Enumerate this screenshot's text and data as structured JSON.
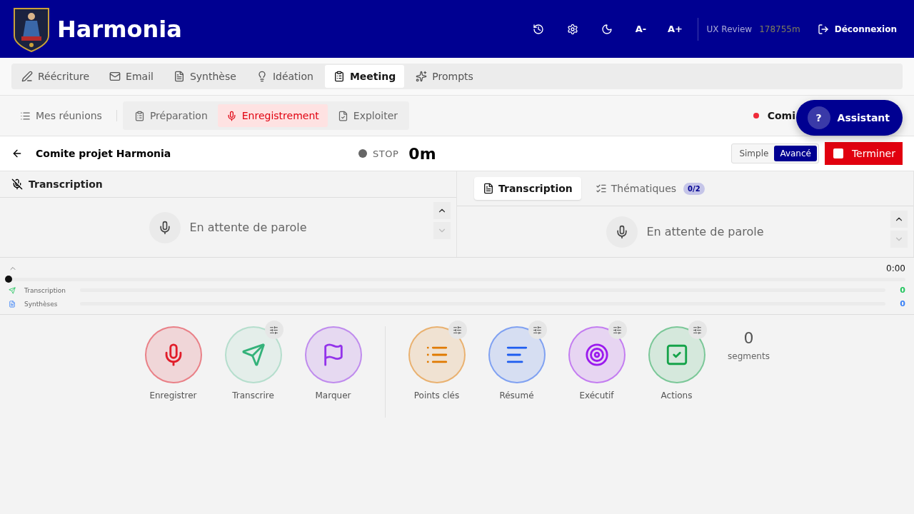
{
  "header": {
    "title": "Harmonia",
    "font_buttons": [
      "A-",
      "A+"
    ],
    "user": "UX Review",
    "usage": "178755m",
    "logout": "Déconnexion"
  },
  "main_tabs": [
    {
      "label": "Réécriture",
      "kind": "pen",
      "selected": false
    },
    {
      "label": "Email",
      "kind": "mail",
      "selected": false
    },
    {
      "label": "Synthèse",
      "kind": "doc",
      "selected": false
    },
    {
      "label": "Idéation",
      "kind": "bulb",
      "selected": false
    },
    {
      "label": "Meeting",
      "kind": "clipboard",
      "selected": true
    },
    {
      "label": "Prompts",
      "kind": "sparkles",
      "selected": false
    }
  ],
  "sub_nav": {
    "list_link": "Mes réunions",
    "steps": [
      {
        "label": "Préparation",
        "kind": "clipboard",
        "selected": false
      },
      {
        "label": "Enregistrement",
        "kind": "mic",
        "selected": true
      },
      {
        "label": "Exploiter",
        "kind": "filecheck",
        "selected": false
      }
    ],
    "status": {
      "text": "Comi",
      "color": "#ef2b3a"
    },
    "assistant": {
      "icon_text": "?",
      "label": "Assistant"
    }
  },
  "meeting_bar": {
    "title": "Comite projet Harmonia",
    "state": "STOP",
    "recording": false,
    "elapsed": "0m",
    "modes": [
      {
        "label": "Simple",
        "selected": false
      },
      {
        "label": "Avancé",
        "selected": true
      }
    ],
    "finish": "Terminer"
  },
  "left_panel": {
    "title": "Transcription",
    "empty_text": "En attente de parole"
  },
  "right_panel": {
    "tabs": [
      {
        "label": "Transcription",
        "kind": "doc",
        "selected": true
      },
      {
        "label": "Thématiques",
        "kind": "checklist",
        "selected": false,
        "badge": "0/2"
      }
    ],
    "empty_text": "En attente de parole"
  },
  "timeline": {
    "time": "0:00",
    "level": 0,
    "tracks": [
      {
        "label": "Transcription",
        "kind": "send",
        "color": "#22c55e",
        "count": "0",
        "level": 0
      },
      {
        "label": "Synthèses",
        "kind": "doc",
        "color": "#3b82f6",
        "count": "0",
        "level": 0
      }
    ]
  },
  "action_groups": [
    {
      "actions": [
        {
          "label": "Enregistrer",
          "kind": "mic",
          "color": "#e11d2a",
          "settings": false,
          "faded": false
        },
        {
          "label": "Transcrire",
          "kind": "send",
          "color": "#34b27a",
          "settings": true,
          "faded": true
        },
        {
          "label": "Marquer",
          "kind": "flag",
          "color": "#9333ea",
          "settings": false,
          "faded": false
        }
      ]
    },
    {
      "actions": [
        {
          "label": "Points clés",
          "kind": "list",
          "color": "#e07a00",
          "settings": true,
          "faded": false
        },
        {
          "label": "Résumé",
          "kind": "summary",
          "color": "#1d5cf0",
          "settings": true,
          "faded": false
        },
        {
          "label": "Exécutif",
          "kind": "target",
          "color": "#9b1aee",
          "settings": true,
          "faded": false
        },
        {
          "label": "Actions",
          "kind": "check",
          "color": "#16a34a",
          "settings": true,
          "faded": false
        }
      ]
    }
  ],
  "segments": {
    "count": "0",
    "label": "segments"
  }
}
